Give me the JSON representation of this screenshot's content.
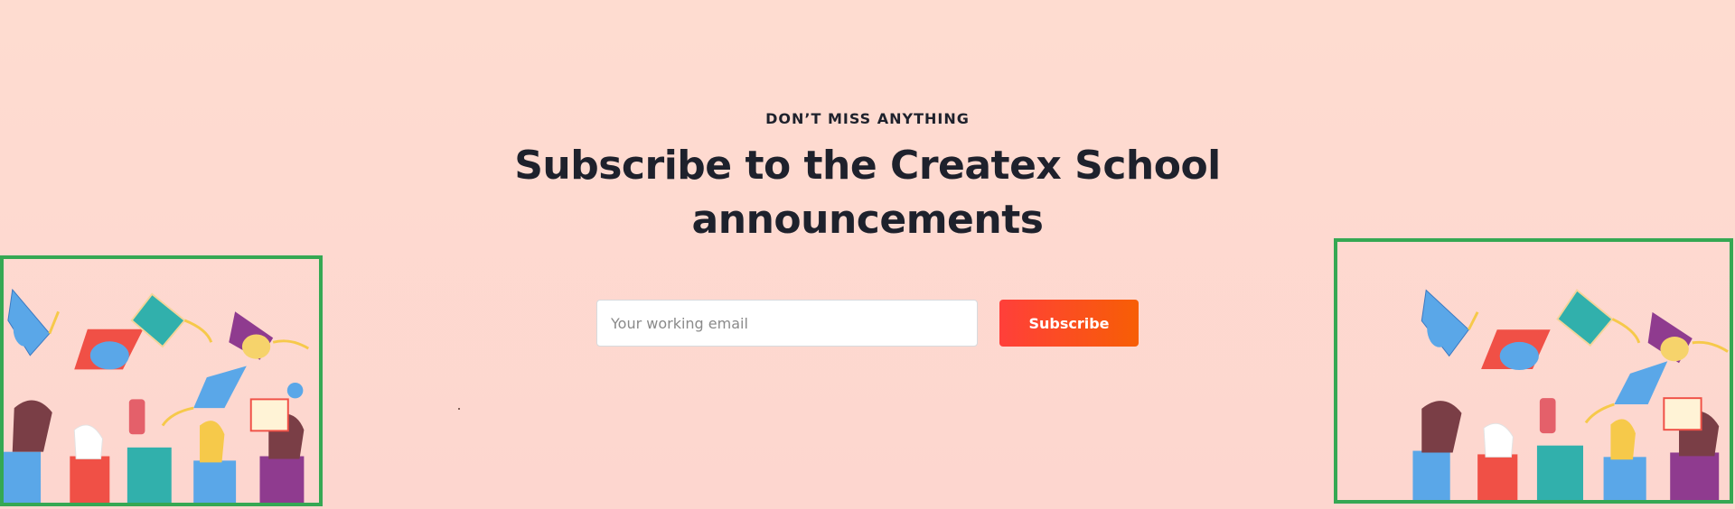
{
  "subscribe_section": {
    "eyebrow": "DON’T MISS ANYTHING",
    "title": "Subscribe to the Createx School announcements",
    "email": {
      "placeholder": "Your working email",
      "value": ""
    },
    "button_label": "Subscribe"
  },
  "colors": {
    "background": "#fedcd0",
    "accent_start": "#ff3f3a",
    "accent_end": "#f75e05",
    "highlight_box": "#35a853",
    "text": "#1e212c"
  },
  "illustrations": [
    {
      "name": "graduation-celebration-left",
      "icon": "graduation-caps-icon"
    },
    {
      "name": "graduation-celebration-right",
      "icon": "graduation-caps-icon"
    }
  ]
}
